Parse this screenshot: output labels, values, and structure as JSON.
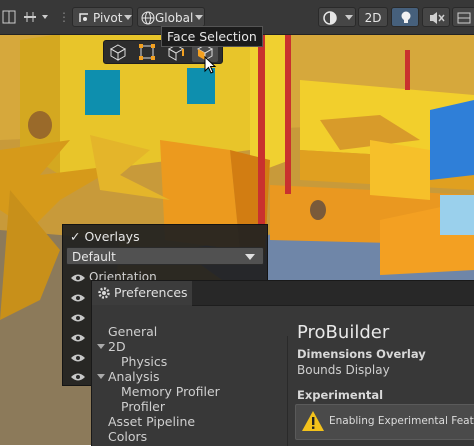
{
  "toolbar": {
    "pivot_label": "Pivot",
    "global_label": "Global",
    "mode_2d_label": "2D"
  },
  "selection": {
    "tooltip": "Face Selection",
    "modes": [
      "object-selection-icon",
      "vertex-selection-icon",
      "edge-selection-icon",
      "face-selection-icon"
    ]
  },
  "overlays_menu": {
    "title": "Overlays",
    "preset": "Default",
    "items": [
      "Orientation"
    ]
  },
  "preferences": {
    "tab_title": "Preferences",
    "tree": [
      {
        "label": "General"
      },
      {
        "label": "2D"
      },
      {
        "label": "Physics"
      },
      {
        "label": "Analysis"
      },
      {
        "label": "Memory Profiler"
      },
      {
        "label": "Profiler"
      },
      {
        "label": "Asset Pipeline"
      },
      {
        "label": "Colors"
      }
    ],
    "section_title": "ProBuilder",
    "subheading": "Dimensions Overlay",
    "field": "Bounds Display",
    "experimental_heading": "Experimental",
    "warning": "Enabling Experimental Features"
  },
  "colors": {
    "toolbar_bg": "#383838",
    "panel_bg": "#383838",
    "accent_blue": "#46607c",
    "warning_yellow": "#f3c21b"
  }
}
